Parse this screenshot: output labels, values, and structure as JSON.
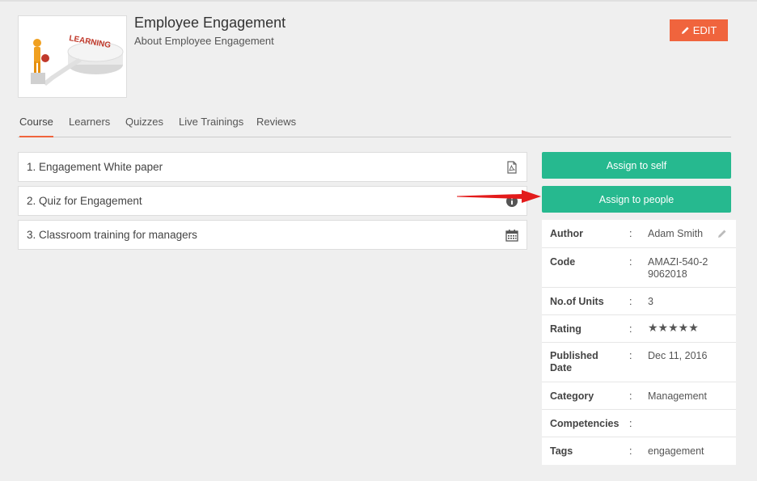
{
  "course": {
    "title": "Employee Engagement",
    "subtitle": "About Employee Engagement",
    "thumbnail_text": "LEARNING"
  },
  "toolbar": {
    "edit_label": "EDIT",
    "edit_icon": "pencil-icon"
  },
  "tabs": [
    {
      "label": "Course",
      "active": true
    },
    {
      "label": "Learners",
      "active": false
    },
    {
      "label": "Quizzes",
      "active": false
    },
    {
      "label": "Live Trainings",
      "active": false
    },
    {
      "label": "Reviews",
      "active": false
    }
  ],
  "items": [
    {
      "label": "1. Engagement White paper",
      "icon": "pdf-icon"
    },
    {
      "label": "2. Quiz for Engagement",
      "icon": "info-icon"
    },
    {
      "label": "3. Classroom training for managers",
      "icon": "calendar-icon"
    }
  ],
  "actions": {
    "assign_self": "Assign to self",
    "assign_people": "Assign to people"
  },
  "details": {
    "separator": ":",
    "rows": [
      {
        "key": "Author",
        "value": "Adam Smith"
      },
      {
        "key": "Code",
        "value": "AMAZI-540-29062018"
      },
      {
        "key": "No.of Units",
        "value": "3"
      },
      {
        "key": "Rating",
        "value": "★★★★★",
        "rating": 0,
        "max": 5
      },
      {
        "key": "Published Date",
        "value": "Dec 11, 2016"
      },
      {
        "key": "Category",
        "value": "Management"
      },
      {
        "key": "Competencies",
        "value": ""
      },
      {
        "key": "Tags",
        "value": "engagement"
      }
    ]
  },
  "colors": {
    "accent": "#f0643d",
    "primary": "#26b98f",
    "arrow": "#e31b1b"
  }
}
